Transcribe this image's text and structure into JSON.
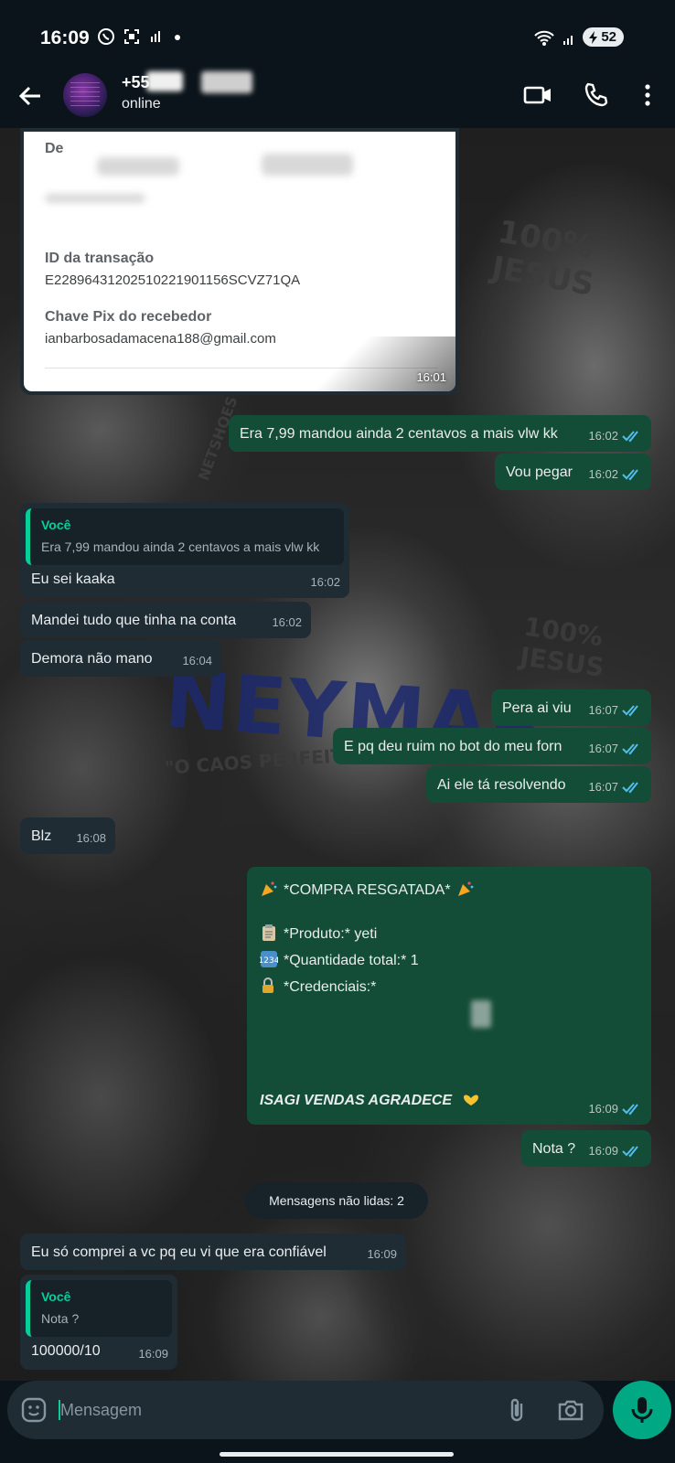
{
  "status_bar": {
    "time": "16:09",
    "battery": "52"
  },
  "header": {
    "contact_name": "+55",
    "contact_status": "online"
  },
  "background": {
    "texts": [
      "100% JESUS",
      "NEYMAR",
      "\"O CAOS PERFEITO\"",
      "100% JESUS",
      "NETSHOES"
    ]
  },
  "receipt": {
    "from_label": "De",
    "txid_label": "ID da transação",
    "txid_value": "E22896431202510221901156SCVZ71QA",
    "pix_label": "Chave Pix do recebedor",
    "pix_value": "ianbarbosadamacena188@gmail.com",
    "time": "16:01"
  },
  "messages": [
    {
      "id": "m1",
      "dir": "out",
      "text": "Era 7,99 mandou ainda 2 centavos a mais vlw kk",
      "time": "16:02"
    },
    {
      "id": "m2",
      "dir": "out",
      "text": "Vou pegar",
      "time": "16:02"
    },
    {
      "id": "m3",
      "dir": "in",
      "quote_name": "Você",
      "quote_text": "Era 7,99 mandou ainda 2 centavos a mais vlw kk",
      "text": "Eu sei kaaka",
      "time": "16:02"
    },
    {
      "id": "m4",
      "dir": "in",
      "text": "Mandei tudo que tinha na conta",
      "time": "16:02"
    },
    {
      "id": "m5",
      "dir": "in",
      "text": "Demora não mano",
      "time": "16:04"
    },
    {
      "id": "m6",
      "dir": "out",
      "text": "Pera ai viu",
      "time": "16:07"
    },
    {
      "id": "m7",
      "dir": "out",
      "text": "E pq deu ruim no bot do meu forn",
      "time": "16:07"
    },
    {
      "id": "m8",
      "dir": "out",
      "text": "Ai ele tá resolvendo",
      "time": "16:07"
    },
    {
      "id": "m9",
      "dir": "in",
      "text": "Blz",
      "time": "16:08"
    },
    {
      "id": "m10",
      "dir": "out",
      "line1": "*COMPRA RESGATADA*",
      "line2": "*Produto:* yeti",
      "line3": "*Quantidade total:* 1",
      "line4": "*Credenciais:*",
      "line5": "ISAGI VENDAS AGRADECE",
      "time": "16:09"
    },
    {
      "id": "m11",
      "dir": "out",
      "text": "Nota ?",
      "time": "16:09"
    },
    {
      "id": "m12",
      "dir": "in",
      "text": "Eu só comprei a vc pq eu vi que era confiável",
      "time": "16:09"
    },
    {
      "id": "m13",
      "dir": "in",
      "quote_name": "Você",
      "quote_text": "Nota ?",
      "text": "100000/10",
      "time": "16:09"
    }
  ],
  "unread_divider": "Mensagens não lidas: 2",
  "composer": {
    "placeholder": "Mensagem"
  },
  "colors": {
    "outgoing": "#144d37",
    "incoming": "#1f2c34",
    "accent": "#00a884",
    "read_tick": "#53bdeb"
  },
  "icons": [
    "whatsapp-icon",
    "screenshot-icon",
    "signal-icon",
    "wifi-icon",
    "back-arrow-icon",
    "video-call-icon",
    "phone-icon",
    "more-vert-icon",
    "emoji-icon",
    "attach-icon",
    "camera-icon",
    "mic-icon",
    "double-check-icon",
    "party-popper-icon",
    "clipboard-icon",
    "numbers-icon",
    "lock-key-icon",
    "heart-hands-icon"
  ]
}
